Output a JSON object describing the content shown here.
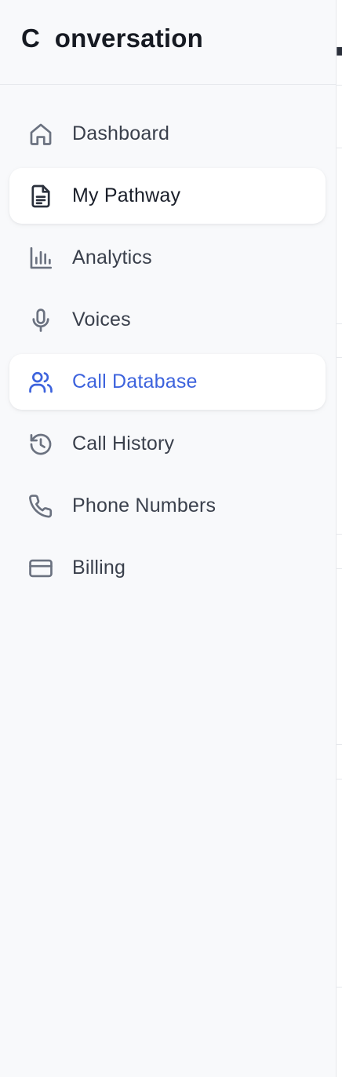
{
  "brand": {
    "title": "C  onversation"
  },
  "nav": {
    "items": [
      {
        "label": "Dashboard",
        "icon": "home-icon"
      },
      {
        "label": "My Pathway",
        "icon": "document-icon",
        "state": "selected"
      },
      {
        "label": "Analytics",
        "icon": "bar-chart-icon"
      },
      {
        "label": "Voices",
        "icon": "microphone-icon"
      },
      {
        "label": "Call Database",
        "icon": "users-icon",
        "state": "active"
      },
      {
        "label": "Call History",
        "icon": "history-icon"
      },
      {
        "label": "Phone Numbers",
        "icon": "phone-icon"
      },
      {
        "label": "Billing",
        "icon": "credit-card-icon"
      }
    ]
  },
  "colors": {
    "accent": "#3d63dd",
    "sidebar_bg": "#f8f9fb",
    "text": "#3a404c"
  }
}
